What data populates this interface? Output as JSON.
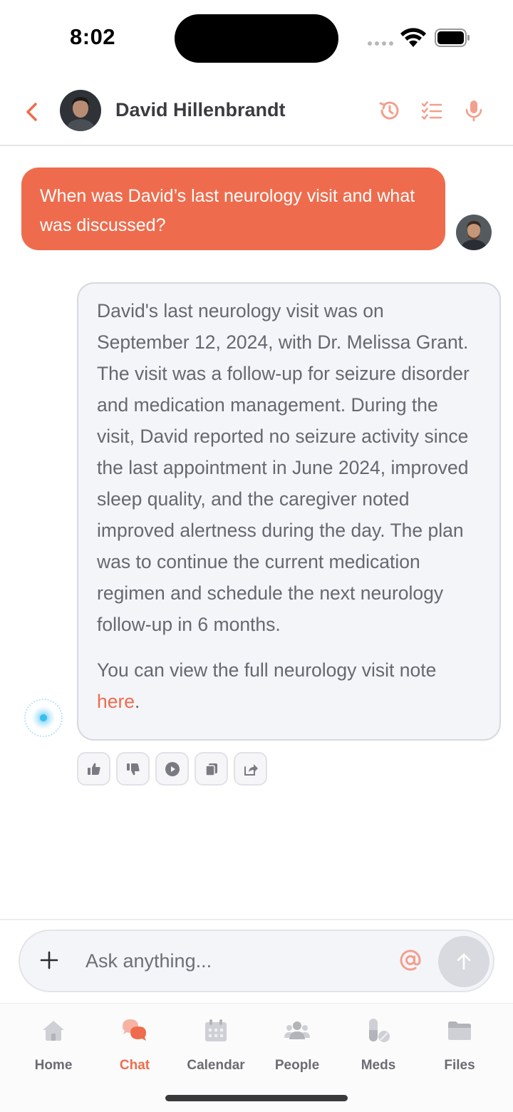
{
  "status_bar": {
    "time": "8:02"
  },
  "header": {
    "contact_name": "David Hillenbrandt"
  },
  "messages": {
    "user_question": "When was David’s last neurology visit and what was discussed?",
    "ai_paragraph_1": "David's last neurology visit was on September 12, 2024, with Dr. Melissa Grant. The visit was a follow-up for seizure disorder and medication management. During the visit, David reported no seizure activity since the last appointment in June 2024, improved sleep quality, and the caregiver noted improved alertness during the day. The plan was to continue the current medication regimen and schedule the next neurology follow-up in 6 months.",
    "ai_paragraph_2_prefix": "You can view the full neurology visit note ",
    "ai_link_text": "here",
    "ai_paragraph_2_suffix": "."
  },
  "composer": {
    "placeholder": "Ask anything..."
  },
  "tabs": [
    {
      "label": "Home",
      "icon": "home-icon"
    },
    {
      "label": "Chat",
      "icon": "chat-icon"
    },
    {
      "label": "Calendar",
      "icon": "calendar-icon"
    },
    {
      "label": "People",
      "icon": "people-icon"
    },
    {
      "label": "Meds",
      "icon": "pill-icon"
    },
    {
      "label": "Files",
      "icon": "folder-icon"
    }
  ],
  "active_tab": "Chat",
  "colors": {
    "accent": "#ee6c4d",
    "bubble_ai": "#f4f5f9",
    "text_muted": "#6b6c73"
  }
}
